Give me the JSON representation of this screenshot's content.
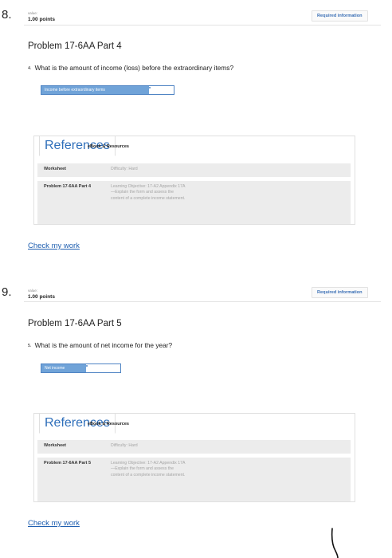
{
  "questions": [
    {
      "number": "8.",
      "value_label": "value:",
      "points": "1.00 points",
      "required_info": "Required information",
      "problem_title": "Problem 17-6AA Part 4",
      "question_number": "4.",
      "question_text": "What is the amount of income (loss) before the extraordinary items?",
      "field_label": "Income before extraordinary items",
      "tabs": {
        "references": "References",
        "ebook": "eBook & Resources"
      },
      "worksheet_label": "Worksheet",
      "difficulty": "Difficulty: Hard",
      "ref_problem": "Problem 17-6AA Part 4",
      "learning_objective": "Learning Objective: 17-A2 Appendix 17A—Explain the form and assess the content of a complete income statement.",
      "check_link": "Check my work"
    },
    {
      "number": "9.",
      "value_label": "value:",
      "points": "1.00 points",
      "required_info": "Required information",
      "problem_title": "Problem 17-6AA Part 5",
      "question_number": "5.",
      "question_text": "What is the amount of net income for the year?",
      "field_label": "Net income",
      "tabs": {
        "references": "References",
        "ebook": "eBook & Resources"
      },
      "worksheet_label": "Worksheet",
      "difficulty": "Difficulty: Hard",
      "ref_problem": "Problem 17-6AA Part 5",
      "learning_objective": "Learning Objective: 17-A2 Appendix 17A—Explain the form and assess the content of a complete income statement.",
      "check_link": "Check my work"
    }
  ],
  "colors": {
    "accent": "#2f6fba",
    "field_label_bg": "#70a3d8",
    "row_bg": "#ececec"
  }
}
